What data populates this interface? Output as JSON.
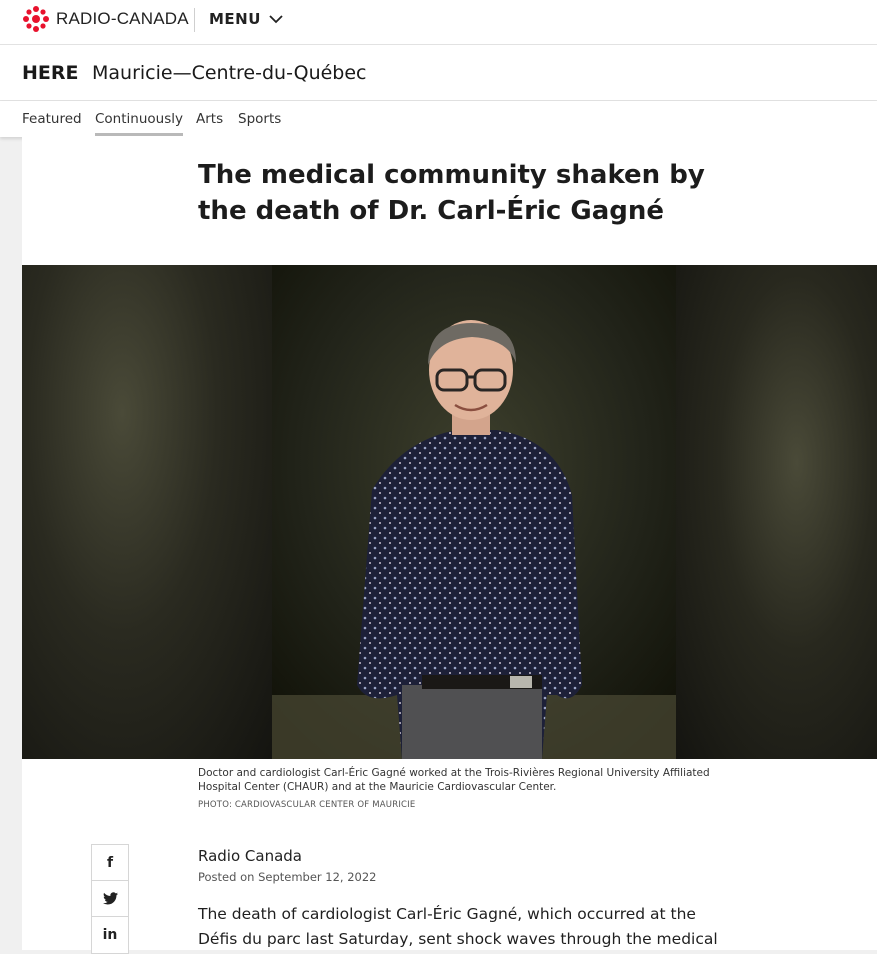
{
  "header": {
    "logo_text": "RADIO-CANADA",
    "menu_label": "MENU"
  },
  "section": {
    "here_label": "HERE",
    "region": "Mauricie—Centre-du-Québec"
  },
  "tabs": [
    {
      "label": "Featured",
      "active": false
    },
    {
      "label": "Continuously",
      "active": true
    },
    {
      "label": "Arts",
      "active": false
    },
    {
      "label": "Sports",
      "active": false
    }
  ],
  "article": {
    "title": "The medical community shaken by the death of Dr. Carl-Éric Gagné",
    "caption": "Doctor and cardiologist Carl-Éric Gagné worked at the Trois-Rivières Regional University Affiliated Hospital Center (CHAUR) and at the Mauricie Cardiovascular Center.",
    "photo_credit": "PHOTO: CARDIOVASCULAR CENTER OF MAURICIE",
    "author": "Radio Canada",
    "posted": "Posted on September 12, 2022",
    "lead": "The death of cardiologist Carl-Éric Gagné, which occurred at the Défis du parc last Saturday, sent shock waves through the medical"
  },
  "share": {
    "facebook": "f",
    "linkedin": "in"
  },
  "colors": {
    "brand_red": "#e8122d"
  }
}
